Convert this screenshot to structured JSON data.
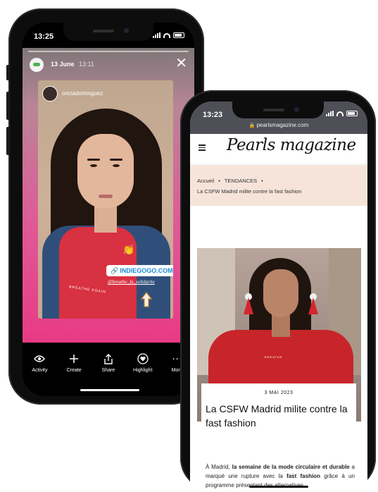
{
  "phone1": {
    "status_time": "13:25",
    "story": {
      "date": "13 June",
      "time": "13:11",
      "username": "oriciadominguez",
      "link_sticker": "INDIEGOGO.COM",
      "mention": "@breathe_la_solidarite",
      "shirt_text": "BREATHE  AGAIN"
    },
    "toolbar": [
      {
        "icon": "activity-eye-icon",
        "label": "Activity"
      },
      {
        "icon": "plus-icon",
        "label": "Create"
      },
      {
        "icon": "share-icon",
        "label": "Share"
      },
      {
        "icon": "highlight-heart-icon",
        "label": "Highlight"
      },
      {
        "icon": "more-icon",
        "label": "More"
      }
    ]
  },
  "phone2": {
    "status_time": "13:23",
    "url": "pearlsmagazine.com",
    "logo": "Pearls magazine",
    "breadcrumb": {
      "home": "Accueil",
      "section": "TENDANCES",
      "current": "La CSFW Madrid milite contre la fast fashion"
    },
    "article": {
      "date": "3 MAI 2023",
      "title": "La CSFW Madrid milite contre la fast fashion",
      "brand_on_shirt": "BREATHE",
      "body_1": "À Madrid, ",
      "body_b1": "la semaine de la mode circulaire et durable",
      "body_2": " a marqué une rupture avec la ",
      "body_b2": "fast fashion",
      "body_3": " grâce à un programme présentant des alternatives"
    }
  }
}
